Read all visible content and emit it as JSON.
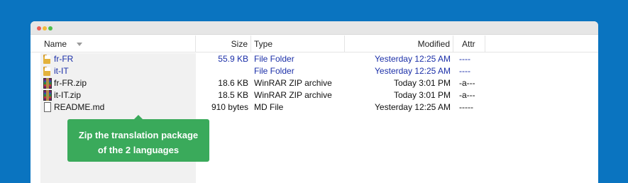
{
  "window": {
    "controls": [
      "close",
      "minimize",
      "maximize"
    ]
  },
  "columns": {
    "name": "Name",
    "size": "Size",
    "type": "Type",
    "modified": "Modified",
    "attr": "Attr"
  },
  "files": [
    {
      "icon": "folder-icon",
      "name": "fr-FR",
      "size": "55.9 KB",
      "type": "File Folder",
      "modified": "Yesterday 12:25 AM",
      "attr": "----",
      "highlight": true
    },
    {
      "icon": "folder-icon",
      "name": "it-IT",
      "size": "",
      "type": "File Folder",
      "modified": "Yesterday 12:25 AM",
      "attr": "----",
      "highlight": true
    },
    {
      "icon": "winrar-zip-icon",
      "name": "fr-FR.zip",
      "size": "18.6 KB",
      "type": "WinRAR ZIP archive",
      "modified": "Today 3:01 PM",
      "attr": "-a---",
      "highlight": false
    },
    {
      "icon": "winrar-zip-icon",
      "name": "it-IT.zip",
      "size": "18.5 KB",
      "type": "WinRAR ZIP archive",
      "modified": "Today 3:01 PM",
      "attr": "-a---",
      "highlight": false
    },
    {
      "icon": "document-icon",
      "name": "README.md",
      "size": "910 bytes",
      "type": "MD File",
      "modified": "Yesterday 12:25 AM",
      "attr": "-----",
      "highlight": false
    }
  ],
  "tooltip": {
    "line1": "Zip the translation package",
    "line2": "of the 2 languages"
  },
  "colors": {
    "background": "#0a74c0",
    "highlight_text": "#1b2fa8",
    "tooltip": "#3aaa5b"
  }
}
